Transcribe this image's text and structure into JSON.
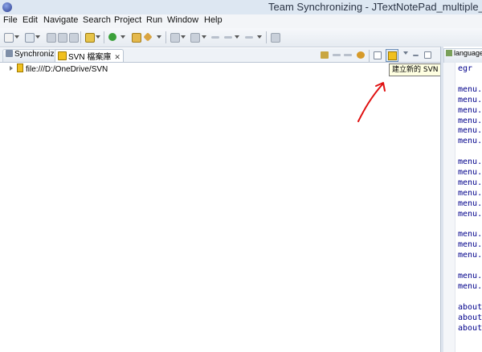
{
  "window": {
    "title": "Team Synchronizing - JTextNotePad_multiple_"
  },
  "menubar": {
    "items": [
      "File",
      "Edit",
      "Navigate",
      "Search",
      "Project",
      "Run",
      "Window",
      "Help"
    ]
  },
  "tabs": [
    {
      "label": "Synchronize",
      "icon": "synchronize-icon",
      "active": false
    },
    {
      "label": "SVN 檔案庫",
      "icon": "svn-repository-icon",
      "active": true,
      "close": "✕"
    }
  ],
  "tree": {
    "items": [
      {
        "label": "file:///D:/OneDrive/SVN",
        "icon": "repository-icon"
      }
    ]
  },
  "tooltip": {
    "text": "建立新的 SVN 檔案庫"
  },
  "editor": {
    "tab_label": "language_",
    "lines": [
      "egr",
      "",
      "menu.",
      "menu.",
      "menu.",
      "menu.",
      "menu.",
      "menu.",
      "",
      "menu.",
      "menu.",
      "menu.",
      "menu.",
      "menu.",
      "menu.",
      "",
      "menu.",
      "menu.",
      "menu.",
      "",
      "menu.",
      "menu.",
      "",
      "about",
      "about",
      "about"
    ]
  },
  "colors": {
    "annotation_arrow": "#e01010",
    "code_text": "#00008b"
  }
}
